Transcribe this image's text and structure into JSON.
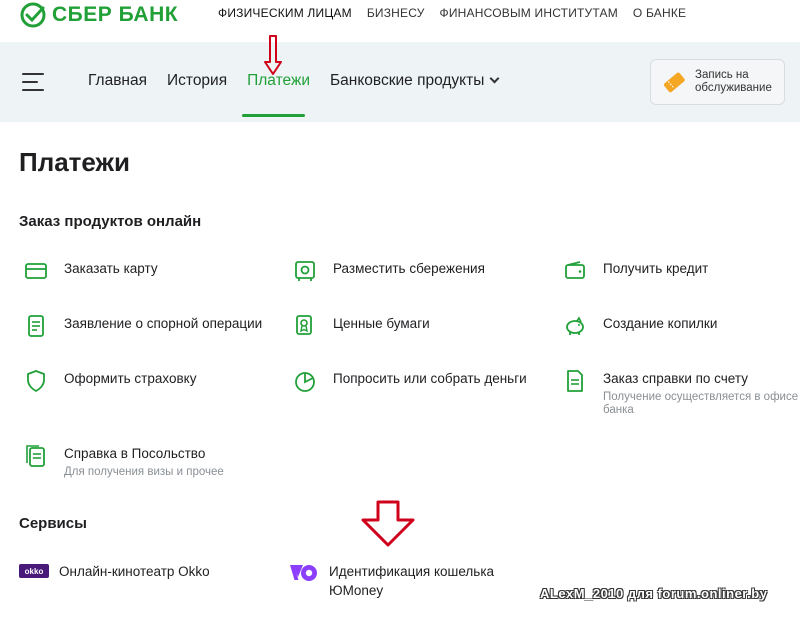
{
  "brand": {
    "name": "СБЕР БАНК",
    "color": "#21a038"
  },
  "topnav": [
    "ФИЗИЧЕСКИМ ЛИЦАМ",
    "БИЗНЕСУ",
    "ФИНАНСОВЫМ ИНСТИТУТАМ",
    "О БАНКЕ"
  ],
  "mainnav": {
    "items": [
      "Главная",
      "История",
      "Платежи",
      "Банковские продукты"
    ],
    "active": "Платежи",
    "appointment_label": "Запись на обслуживание"
  },
  "page": {
    "title": "Платежи"
  },
  "orders": {
    "title": "Заказ продуктов онлайн",
    "items": [
      {
        "label": "Заказать карту",
        "icon": "card-icon"
      },
      {
        "label": "Разместить сбережения",
        "icon": "safe-icon"
      },
      {
        "label": "Получить кредит",
        "icon": "wallet-icon"
      },
      {
        "label": "Заявление о спорной операции",
        "icon": "document-icon"
      },
      {
        "label": "Ценные бумаги",
        "icon": "certificate-icon"
      },
      {
        "label": "Создание копилки",
        "icon": "piggy-bank-icon"
      },
      {
        "label": "Оформить страховку",
        "icon": "shield-icon"
      },
      {
        "label": "Попросить или собрать деньги",
        "icon": "pie-chart-icon"
      },
      {
        "label": "Заказ справки по счету",
        "sub": "Получение осуществляется в офисе банка",
        "icon": "document-icon"
      },
      {
        "label": "Справка в Посольство",
        "sub": "Для получения визы и прочее",
        "icon": "documents-icon"
      }
    ]
  },
  "services": {
    "title": "Сервисы",
    "items": [
      {
        "label": "Онлайн-кинотеатр Okko",
        "logo": "okko"
      },
      {
        "label": "Идентификация кошелька ЮMoney",
        "icon": "yoomoney-icon"
      }
    ]
  },
  "watermark": "ALexM_2010 для forum.onliner.by",
  "colors": {
    "accent": "#21a038",
    "nav_bg": "#eef4f6",
    "arrow": "#d0021b",
    "appointment_icon": "#f5a623"
  }
}
